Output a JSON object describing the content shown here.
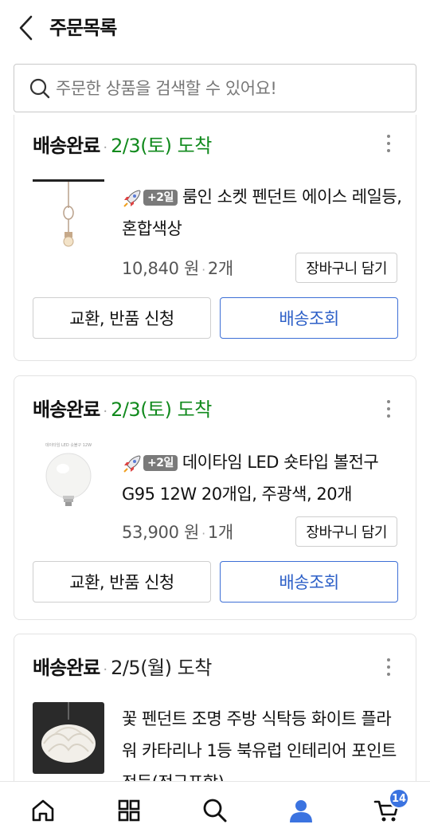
{
  "header": {
    "title": "주문목록"
  },
  "search": {
    "placeholder": "주문한 상품을 검색할 수 있어요!"
  },
  "orders": [
    {
      "status": "배송완료",
      "arrival": "2/3(토) 도착",
      "arrival_color": "#118a1d",
      "badge": "+2일",
      "product_name": "룸인 소켓 펜던트 에이스 레일등, 혼합색상",
      "price": "10,840 원",
      "qty": "2개",
      "cart_label": "장바구니 담기",
      "exchange_label": "교환, 반품 신청",
      "track_label": "배송조회"
    },
    {
      "status": "배송완료",
      "arrival": "2/3(토) 도착",
      "arrival_color": "#118a1d",
      "badge": "+2일",
      "product_name": "데이타임 LED 숏타입 볼전구 G95 12W 20개입, 주광색, 20개",
      "thumb_caption": "데이타임 LED 숏볼구 12W",
      "price": "53,900 원",
      "qty": "1개",
      "cart_label": "장바구니 담기",
      "exchange_label": "교환, 반품 신청",
      "track_label": "배송조회"
    },
    {
      "status": "배송완료",
      "arrival": "2/5(월) 도착",
      "arrival_color": "#222222",
      "product_name": "꽃 펜던트 조명 주방 식탁등 화이트 플라워 카타리나 1등 북유럽 인테리어 포인트 전등(전구포함)"
    }
  ],
  "nav": {
    "items": [
      "home-icon",
      "category-icon",
      "search-icon",
      "my-page-icon",
      "cart-icon"
    ],
    "active": "my-page-icon",
    "active_color": "#3b73e0",
    "cart_count": "14"
  }
}
